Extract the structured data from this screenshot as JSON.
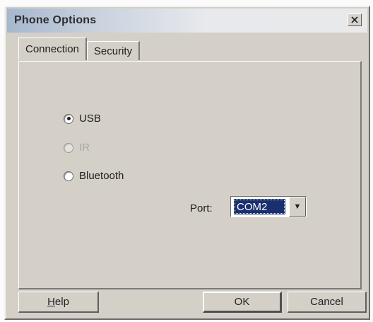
{
  "window": {
    "title": "Phone Options"
  },
  "tabs": [
    {
      "label": "Connection",
      "active": true
    },
    {
      "label": "Security",
      "active": false
    }
  ],
  "connection": {
    "options": [
      {
        "label": "USB",
        "selected": true,
        "enabled": true
      },
      {
        "label": "IR",
        "selected": false,
        "enabled": false
      },
      {
        "label": "Bluetooth",
        "selected": false,
        "enabled": true
      }
    ],
    "port": {
      "label": "Port:",
      "value": "COM2"
    }
  },
  "buttons": {
    "help": "Help",
    "ok": "OK",
    "cancel": "Cancel"
  },
  "icons": {
    "close": "close-icon",
    "dropdown": "chevron-down-icon"
  },
  "colors": {
    "selection": "#1a2f6d",
    "window_bg": "#d4d0c8"
  }
}
